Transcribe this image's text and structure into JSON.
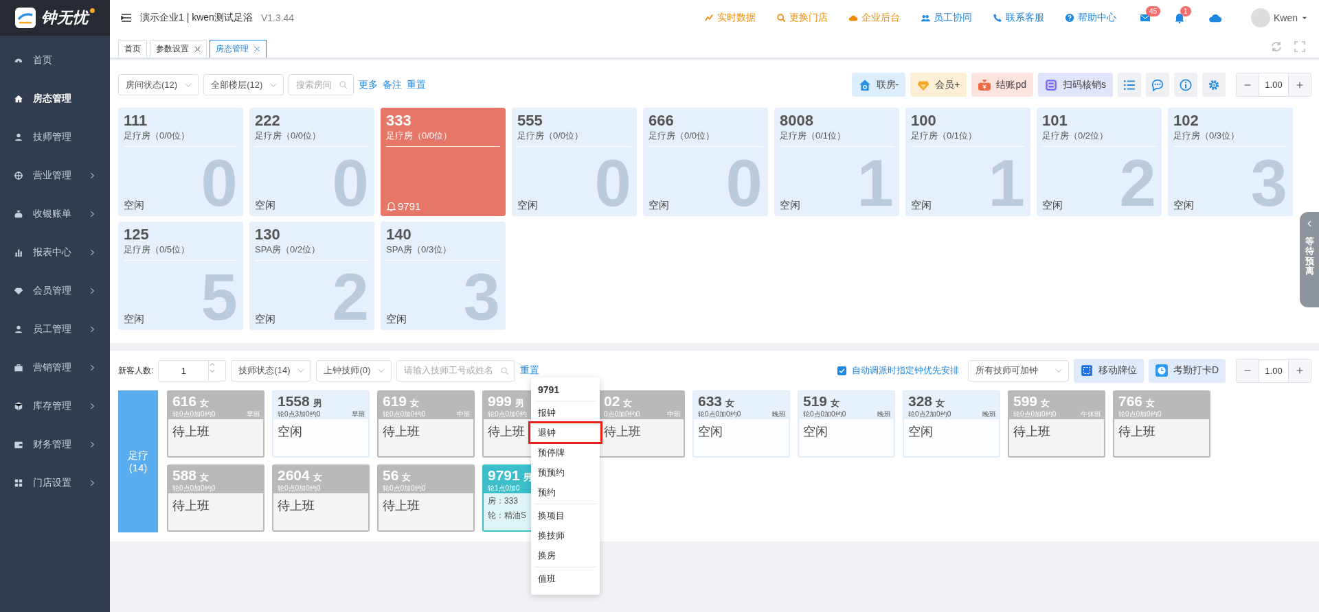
{
  "logo": {
    "name": "钟无忧"
  },
  "sidebar": {
    "items": [
      {
        "label": "首页",
        "selected": false,
        "expandable": false
      },
      {
        "label": "房态管理",
        "selected": true,
        "expandable": false
      },
      {
        "label": "技师管理",
        "selected": false,
        "expandable": false
      },
      {
        "label": "营业管理",
        "selected": false,
        "expandable": true
      },
      {
        "label": "收银账单",
        "selected": false,
        "expandable": true
      },
      {
        "label": "报表中心",
        "selected": false,
        "expandable": true
      },
      {
        "label": "会员管理",
        "selected": false,
        "expandable": true
      },
      {
        "label": "员工管理",
        "selected": false,
        "expandable": true
      },
      {
        "label": "营销管理",
        "selected": false,
        "expandable": true
      },
      {
        "label": "库存管理",
        "selected": false,
        "expandable": true
      },
      {
        "label": "财务管理",
        "selected": false,
        "expandable": true
      },
      {
        "label": "门店设置",
        "selected": false,
        "expandable": true
      }
    ]
  },
  "header": {
    "title": "演示企业1 | kwen测试足浴",
    "version": "V1.3.44",
    "links": [
      {
        "label": "实时数据",
        "color": "#f08c00"
      },
      {
        "label": "更换门店",
        "color": "#f08c00"
      },
      {
        "label": "企业后台",
        "color": "#f08c00"
      },
      {
        "label": "员工协同",
        "color": "#1e88e5"
      },
      {
        "label": "联系客服",
        "color": "#1e88e5"
      },
      {
        "label": "帮助中心",
        "color": "#1e88e5"
      }
    ],
    "mail_badge": "45",
    "bell_badge": "1",
    "user": "Kwen"
  },
  "tabs": [
    {
      "label": "首页",
      "selected": false,
      "closable": false
    },
    {
      "label": "参数设置",
      "selected": false,
      "closable": true
    },
    {
      "label": "房态管理",
      "selected": true,
      "closable": true
    }
  ],
  "rooms": {
    "filters": [
      {
        "kind": "select",
        "label": "房间状态(12)"
      },
      {
        "kind": "select",
        "label": "全部楼层(12)"
      },
      {
        "kind": "search",
        "placeholder": "搜索房间"
      }
    ],
    "links": [
      "更多",
      "备注",
      "重置"
    ],
    "actions": [
      {
        "label": "联房-",
        "color": "#dcedfc"
      },
      {
        "label": "会员+",
        "color": "#fdefd6"
      },
      {
        "label": "结账pd",
        "color": "#fde3dd"
      },
      {
        "label": "扫码核销s",
        "color": "#e0e5fb"
      }
    ],
    "zoom": "1.00",
    "cards": [
      {
        "number": "111",
        "type": "足疗房（0/0位）",
        "status": "空闲",
        "count": "0",
        "occupied": false
      },
      {
        "number": "222",
        "type": "足疗房（0/0位）",
        "status": "空闲",
        "count": "0",
        "occupied": false
      },
      {
        "number": "333",
        "type": "足疗房（0/0位）",
        "status": "9791",
        "occupied": true
      },
      {
        "number": "555",
        "type": "足疗房（0/0位）",
        "status": "空闲",
        "count": "0",
        "occupied": false
      },
      {
        "number": "666",
        "type": "足疗房（0/0位）",
        "status": "空闲",
        "count": "0",
        "occupied": false
      },
      {
        "number": "8008",
        "type": "足疗房（0/1位）",
        "status": "空闲",
        "count": "1",
        "occupied": false
      },
      {
        "number": "100",
        "type": "足疗房（0/1位）",
        "status": "空闲",
        "count": "1",
        "occupied": false
      },
      {
        "number": "101",
        "type": "足疗房（0/2位）",
        "status": "空闲",
        "count": "2",
        "occupied": false
      },
      {
        "number": "102",
        "type": "足疗房（0/3位）",
        "status": "空闲",
        "count": "3",
        "occupied": false
      },
      {
        "number": "125",
        "type": "足疗房（0/5位）",
        "status": "空闲",
        "count": "5",
        "occupied": false
      },
      {
        "number": "130",
        "type": "SPA房（0/2位）",
        "status": "空闲",
        "count": "2",
        "occupied": false
      },
      {
        "number": "140",
        "type": "SPA房（0/3位）",
        "status": "空闲",
        "count": "3",
        "occupied": false
      }
    ]
  },
  "side_tab": {
    "label": "等待预离"
  },
  "techs": {
    "guests_label": "新客人数:",
    "guests": "1",
    "filters": [
      {
        "kind": "select",
        "label": "技师状态(14)"
      },
      {
        "kind": "select",
        "label": "上钟技师(0)"
      },
      {
        "kind": "search",
        "placeholder": "请输入技师工号或姓名"
      }
    ],
    "reset": "重置",
    "auto_dispatch": {
      "label": "自动调派时指定钟优先安排",
      "checked": true
    },
    "extra_select": "所有技师可加钟",
    "actions": [
      {
        "label": "移动牌位"
      },
      {
        "label": "考勤打卡D"
      }
    ],
    "zoom": "1.00",
    "groups": [
      {
        "label": "足疗",
        "count": "(14)",
        "cards": [
          {
            "number": "616",
            "gender": "女",
            "stats": "轮0点0加0约0",
            "shift": "早班",
            "status": "待上班",
            "kind": "off",
            "covered": false
          },
          {
            "number": "1558",
            "gender": "男",
            "stats": "轮0点3加0约0",
            "shift": "早班",
            "status": "空闲",
            "kind": "idle",
            "covered": false
          },
          {
            "number": "619",
            "gender": "女",
            "stats": "轮0点0加0约0",
            "shift": "中班",
            "status": "待上班",
            "kind": "off",
            "covered": false
          },
          {
            "number": "999",
            "gender": "男",
            "stats": "轮0点0加0约",
            "status": "待上班",
            "kind": "off",
            "covered": false
          },
          {
            "number": "02",
            "gender": "女",
            "stats": "0点0加0约0",
            "shift": "中班",
            "status": "待上班",
            "kind": "off",
            "covered": true
          },
          {
            "number": "633",
            "gender": "女",
            "stats": "轮0点0加0约0",
            "shift": "晚班",
            "status": "空闲",
            "kind": "idle",
            "covered": false
          },
          {
            "number": "519",
            "gender": "女",
            "stats": "轮0点0加0约0",
            "shift": "晚班",
            "status": "空闲",
            "kind": "idle",
            "covered": false
          },
          {
            "number": "328",
            "gender": "女",
            "stats": "轮0点2加0约0",
            "shift": "晚班",
            "status": "空闲",
            "kind": "idle",
            "covered": false
          },
          {
            "number": "599",
            "gender": "女",
            "stats": "轮0点0加0约0",
            "shift": "午休班",
            "status": "待上班",
            "kind": "off",
            "covered": false
          },
          {
            "number": "766",
            "gender": "女",
            "stats": "轮0点0加0约0",
            "status": "待上班",
            "kind": "off",
            "covered": false
          },
          {
            "number": "588",
            "gender": "女",
            "stats": "轮0点0加0约0",
            "status": "待上班",
            "kind": "off",
            "covered": false
          },
          {
            "number": "2604",
            "gender": "女",
            "stats": "轮0点0加0约0",
            "status": "待上班",
            "kind": "off",
            "covered": false
          },
          {
            "number": "56",
            "gender": "女",
            "stats": "轮0点0加0约0",
            "status": "待上班",
            "kind": "off",
            "covered": false
          },
          {
            "number": "9791",
            "gender": "男",
            "stats": "轮1点0加0",
            "details": [
              "房：333",
              "轮：精油S"
            ],
            "kind": "busy",
            "covered": false
          }
        ]
      }
    ]
  },
  "context_menu": {
    "title": "9791",
    "sections": [
      [
        {
          "label": "报钟",
          "highlighted": false
        },
        {
          "label": "退钟",
          "highlighted": true
        },
        {
          "label": "预停牌",
          "highlighted": false
        },
        {
          "label": "预预约",
          "highlighted": false
        },
        {
          "label": "预约",
          "highlighted": false
        }
      ],
      [
        {
          "label": "换项目",
          "highlighted": false
        },
        {
          "label": "换技师",
          "highlighted": false
        },
        {
          "label": "换房",
          "highlighted": false
        }
      ],
      [
        {
          "label": "值班",
          "highlighted": false
        }
      ]
    ]
  }
}
